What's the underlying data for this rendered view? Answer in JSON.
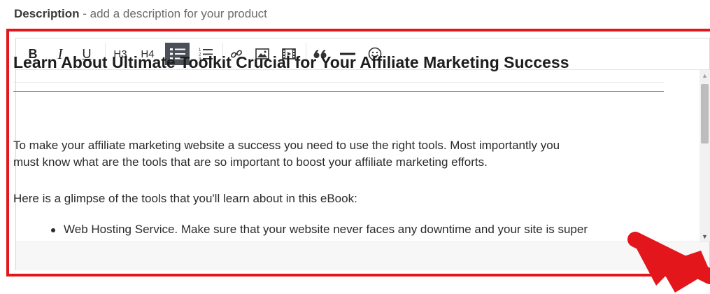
{
  "label": {
    "title": "Description",
    "hint": " - add a description for your product"
  },
  "toolbar": {
    "bold": "B",
    "italic": "I",
    "underline": "U",
    "h3": "H3",
    "h4": "H4",
    "active_button": "bulleted-list"
  },
  "content": {
    "heading": "Learn About Ultimate Toolkit Crucial for Your Affiliate Marketing Success",
    "para1_line1": "To make your affiliate marketing website a success you need to use the right tools. Most importantly you",
    "para1_line2": "must know what are the tools that are so important to boost your affiliate marketing efforts.",
    "para2": "Here is a glimpse of the tools that you'll learn about in this eBook:",
    "bullet1": "Web Hosting Service. Make sure that your website never faces any downtime and your site is super"
  },
  "colors": {
    "highlight_frame": "#e3161b",
    "active_toolbar_button": "#4a4f58"
  }
}
